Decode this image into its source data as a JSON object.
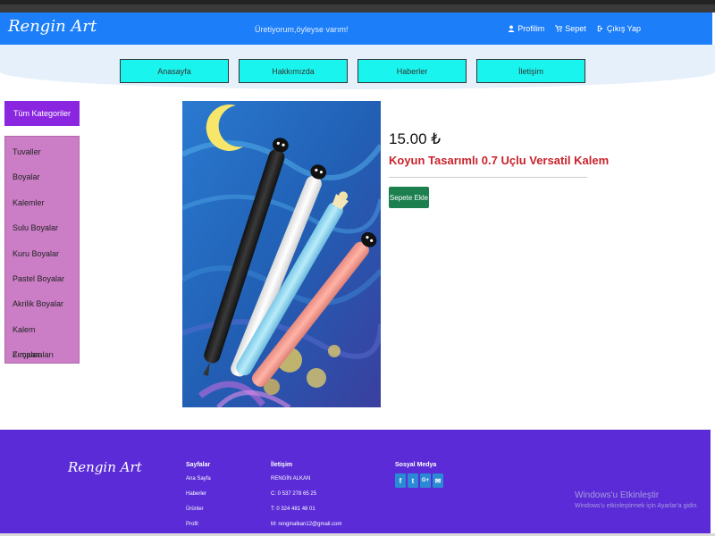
{
  "header": {
    "brand": "Rengin Art",
    "tagline": "Üretiyorum,öyleyse varım!",
    "links": [
      {
        "label": "Profilim",
        "icon": "user-icon"
      },
      {
        "label": "Sepet",
        "icon": "cart-icon"
      },
      {
        "label": "Çıkış Yap",
        "icon": "signout-icon"
      }
    ]
  },
  "menu": [
    "Anasayfa",
    "Hakkımızda",
    "Haberler",
    "İletişim"
  ],
  "sidebar": {
    "title": "Tüm Kategoriler",
    "items": [
      "Tuvaller",
      "Boyalar",
      "Kalemler",
      "Sulu Boyalar",
      "Kuru Boyalar",
      "Pastel Boyalar",
      "Akrilik Boyalar",
      "Kalem Zımparaları",
      "Fırçalar"
    ]
  },
  "product": {
    "price": "15.00 ₺",
    "name": "Koyun Tasarımlı 0.7 Uçlu Versatil Kalem",
    "cart_button": "Sepete Ekle"
  },
  "footer": {
    "brand": "Rengin Art",
    "pages_title": "Sayfalar",
    "pages": [
      "Ana Sayfa",
      "Haberler",
      "Ürünler",
      "Profil"
    ],
    "contact_title": "İletişim",
    "contact": [
      "RENGİN ALKAN",
      "C: 0 537 278 65 25",
      "T: 0 324 481 48 01",
      "M: renginalkan12@gmail.com"
    ],
    "social_title": "Sosyal Medya",
    "social": [
      {
        "glyph": "f",
        "icon": "facebook-icon"
      },
      {
        "glyph": "t",
        "icon": "twitter-icon"
      },
      {
        "glyph": "G+",
        "icon": "google-plus-icon"
      },
      {
        "glyph": "✉",
        "icon": "mail-icon"
      }
    ]
  },
  "watermark": {
    "title": "Windows'u Etkinleştir",
    "subtitle": "Windows'u etkinleştirmek için Ayarlar'a gidin."
  },
  "colors": {
    "navbar": "#1c7ef9",
    "menu_button": "#19f5ee",
    "sidebar_header": "#8a26e0",
    "sidebar_list": "#cb7ec6",
    "price_name": "#c8232c",
    "cart_button": "#1b7f4e",
    "footer": "#5a2bd6"
  }
}
